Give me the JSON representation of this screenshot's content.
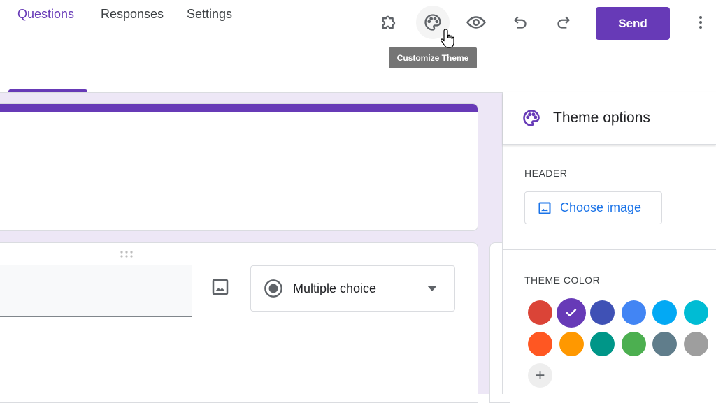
{
  "toolbar": {
    "addons_icon": "puzzle-icon",
    "theme_icon": "palette-icon",
    "preview_icon": "eye-icon",
    "undo_icon": "undo-icon",
    "redo_icon": "redo-icon",
    "send_label": "Send",
    "more_icon": "more-vert-icon",
    "tooltip": "Customize Theme",
    "accent": "#673ab7"
  },
  "tabs": [
    {
      "label": "Questions",
      "active": true
    },
    {
      "label": "Responses",
      "active": false
    },
    {
      "label": "Settings",
      "active": false
    }
  ],
  "question": {
    "type_label": "Multiple choice"
  },
  "theme_panel": {
    "title": "Theme options",
    "header_label": "HEADER",
    "choose_image_label": "Choose image",
    "theme_color_label": "THEME COLOR",
    "colors": [
      {
        "hex": "#db4437",
        "selected": false
      },
      {
        "hex": "#673ab7",
        "selected": true
      },
      {
        "hex": "#3f51b5",
        "selected": false
      },
      {
        "hex": "#4285f4",
        "selected": false
      },
      {
        "hex": "#03a9f4",
        "selected": false
      },
      {
        "hex": "#00bcd4",
        "selected": false
      },
      {
        "hex": "#ff5722",
        "selected": false
      },
      {
        "hex": "#ff9800",
        "selected": false
      },
      {
        "hex": "#009688",
        "selected": false
      },
      {
        "hex": "#4caf50",
        "selected": false
      },
      {
        "hex": "#607d8b",
        "selected": false
      },
      {
        "hex": "#9e9e9e",
        "selected": false
      }
    ],
    "add_color_label": "+"
  }
}
